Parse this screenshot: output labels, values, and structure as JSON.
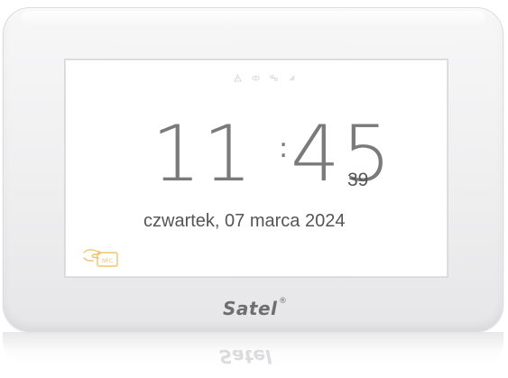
{
  "device": {
    "brand": "Satel",
    "brand_mark": "®",
    "body_color": "#f2f2f3"
  },
  "screen": {
    "status_icons": [
      "warning-icon",
      "eye-icon",
      "network-icon",
      "signal-icon"
    ],
    "clock": {
      "hours": "11",
      "separator": ":",
      "minutes": "45",
      "seconds": "39"
    },
    "date": "czwartek, 07 marca 2024",
    "nfc_icon": "nfc-card-icon",
    "nfc_label": "NFC",
    "nfc_color": "#f1c46a",
    "text_color": "#555555"
  }
}
